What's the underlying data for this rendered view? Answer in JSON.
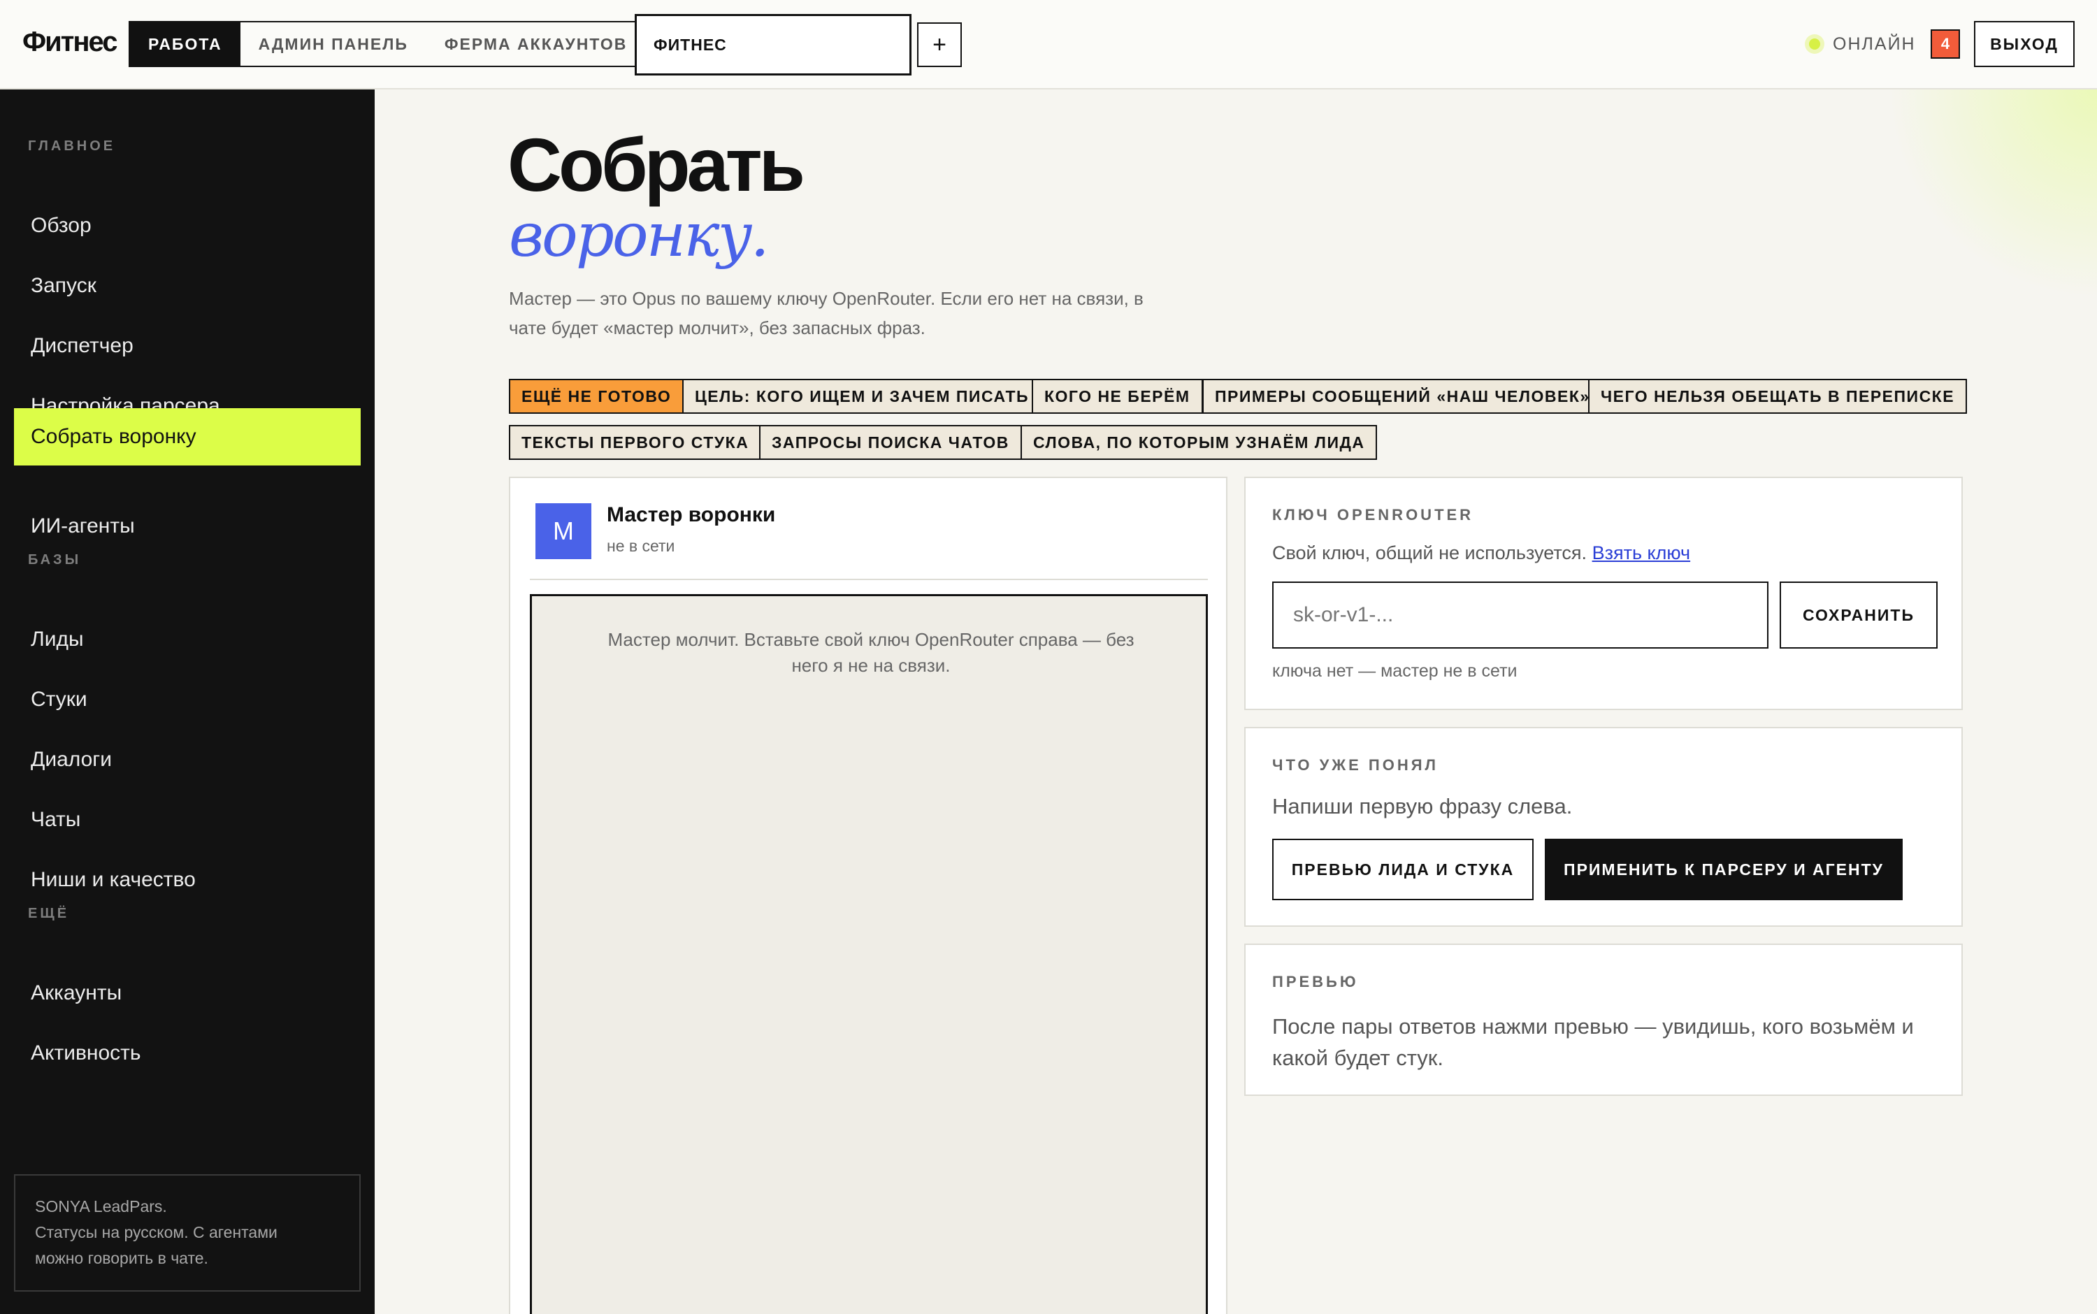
{
  "app": {
    "logo": "Фитнес",
    "mode_tabs": [
      "РАБОТА",
      "АДМИН ПАНЕЛЬ",
      "ФЕРМА АККАУНТОВ"
    ],
    "project_name": "ФИТНЕС",
    "add_label": "+",
    "online_label": "ОНЛАЙН",
    "notifications_count": "4",
    "logout_label": "ВЫХОД"
  },
  "sidebar": {
    "section_main": "ГЛАВНОЕ",
    "section_bases": "БАЗЫ",
    "section_more": "ЕЩЁ",
    "items": [
      "Обзор",
      "Запуск",
      "Диспетчер",
      "Настройка парсера",
      "Собрать воронку",
      "ИИ-агенты",
      "Лиды",
      "Стуки",
      "Диалоги",
      "Чаты",
      "Ниши и качество",
      "Аккаунты",
      "Активность"
    ],
    "active_item": "Собрать воронку",
    "note_lines": [
      "SONYA LeadPars.",
      "Статусы на русском. С агентами",
      "можно говорить в чате."
    ]
  },
  "page": {
    "title_line1": "Собрать",
    "title_line2": "воронку.",
    "lead": "Мастер — это Opus по вашему ключу OpenRouter. Если его нет на связи, в чате будет «мастер молчит», без запасных фраз.",
    "chips": [
      "ЕЩЁ НЕ ГОТОВО",
      "ЦЕЛЬ: КОГО ИЩЕМ И ЗАЧЕМ ПИСАТЬ",
      "КОГО НЕ БЕРЁМ",
      "ПРИМЕРЫ СООБЩЕНИЙ «НАШ ЧЕЛОВЕК»",
      "ЧЕГО НЕЛЬЗЯ ОБЕЩАТЬ В ПЕРЕПИСКЕ",
      "ТЕКСТЫ ПЕРВОГО СТУКА",
      "ЗАПРОСЫ ПОИСКА ЧАТОВ",
      "СЛОВА, ПО КОТОРЫМ УЗНАЁМ ЛИДА"
    ]
  },
  "chat": {
    "avatar_letter": "М",
    "name": "Мастер воронки",
    "status": "не в сети",
    "empty_message": "Мастер молчит. Вставьте свой ключ OpenRouter справа — без него я не на связи."
  },
  "key_card": {
    "label": "КЛЮЧ OPENROUTER",
    "hint": "Свой ключ, общий не используется.",
    "link": "Взять ключ",
    "placeholder": "sk-or-v1-...",
    "save_label": "СОХРАНИТЬ",
    "status": "ключа нет — мастер не в сети"
  },
  "understood_card": {
    "label": "ЧТО УЖЕ ПОНЯЛ",
    "text": "Напиши первую фразу слева.",
    "preview_button": "ПРЕВЬЮ ЛИДА И СТУКА",
    "apply_button": "ПРИМЕНИТЬ К ПАРСЕРУ И АГЕНТУ"
  },
  "preview_card": {
    "label": "ПРЕВЬЮ",
    "text": "После пары ответов нажми превью — увидишь, кого возьмём и какой будет стук."
  },
  "colors": {
    "accent_lime": "#dcfd48",
    "accent_blue": "#4a62e8",
    "chip_warning": "#f99d3a",
    "badge_red": "#f25c3a",
    "sidebar_bg": "#121212"
  }
}
